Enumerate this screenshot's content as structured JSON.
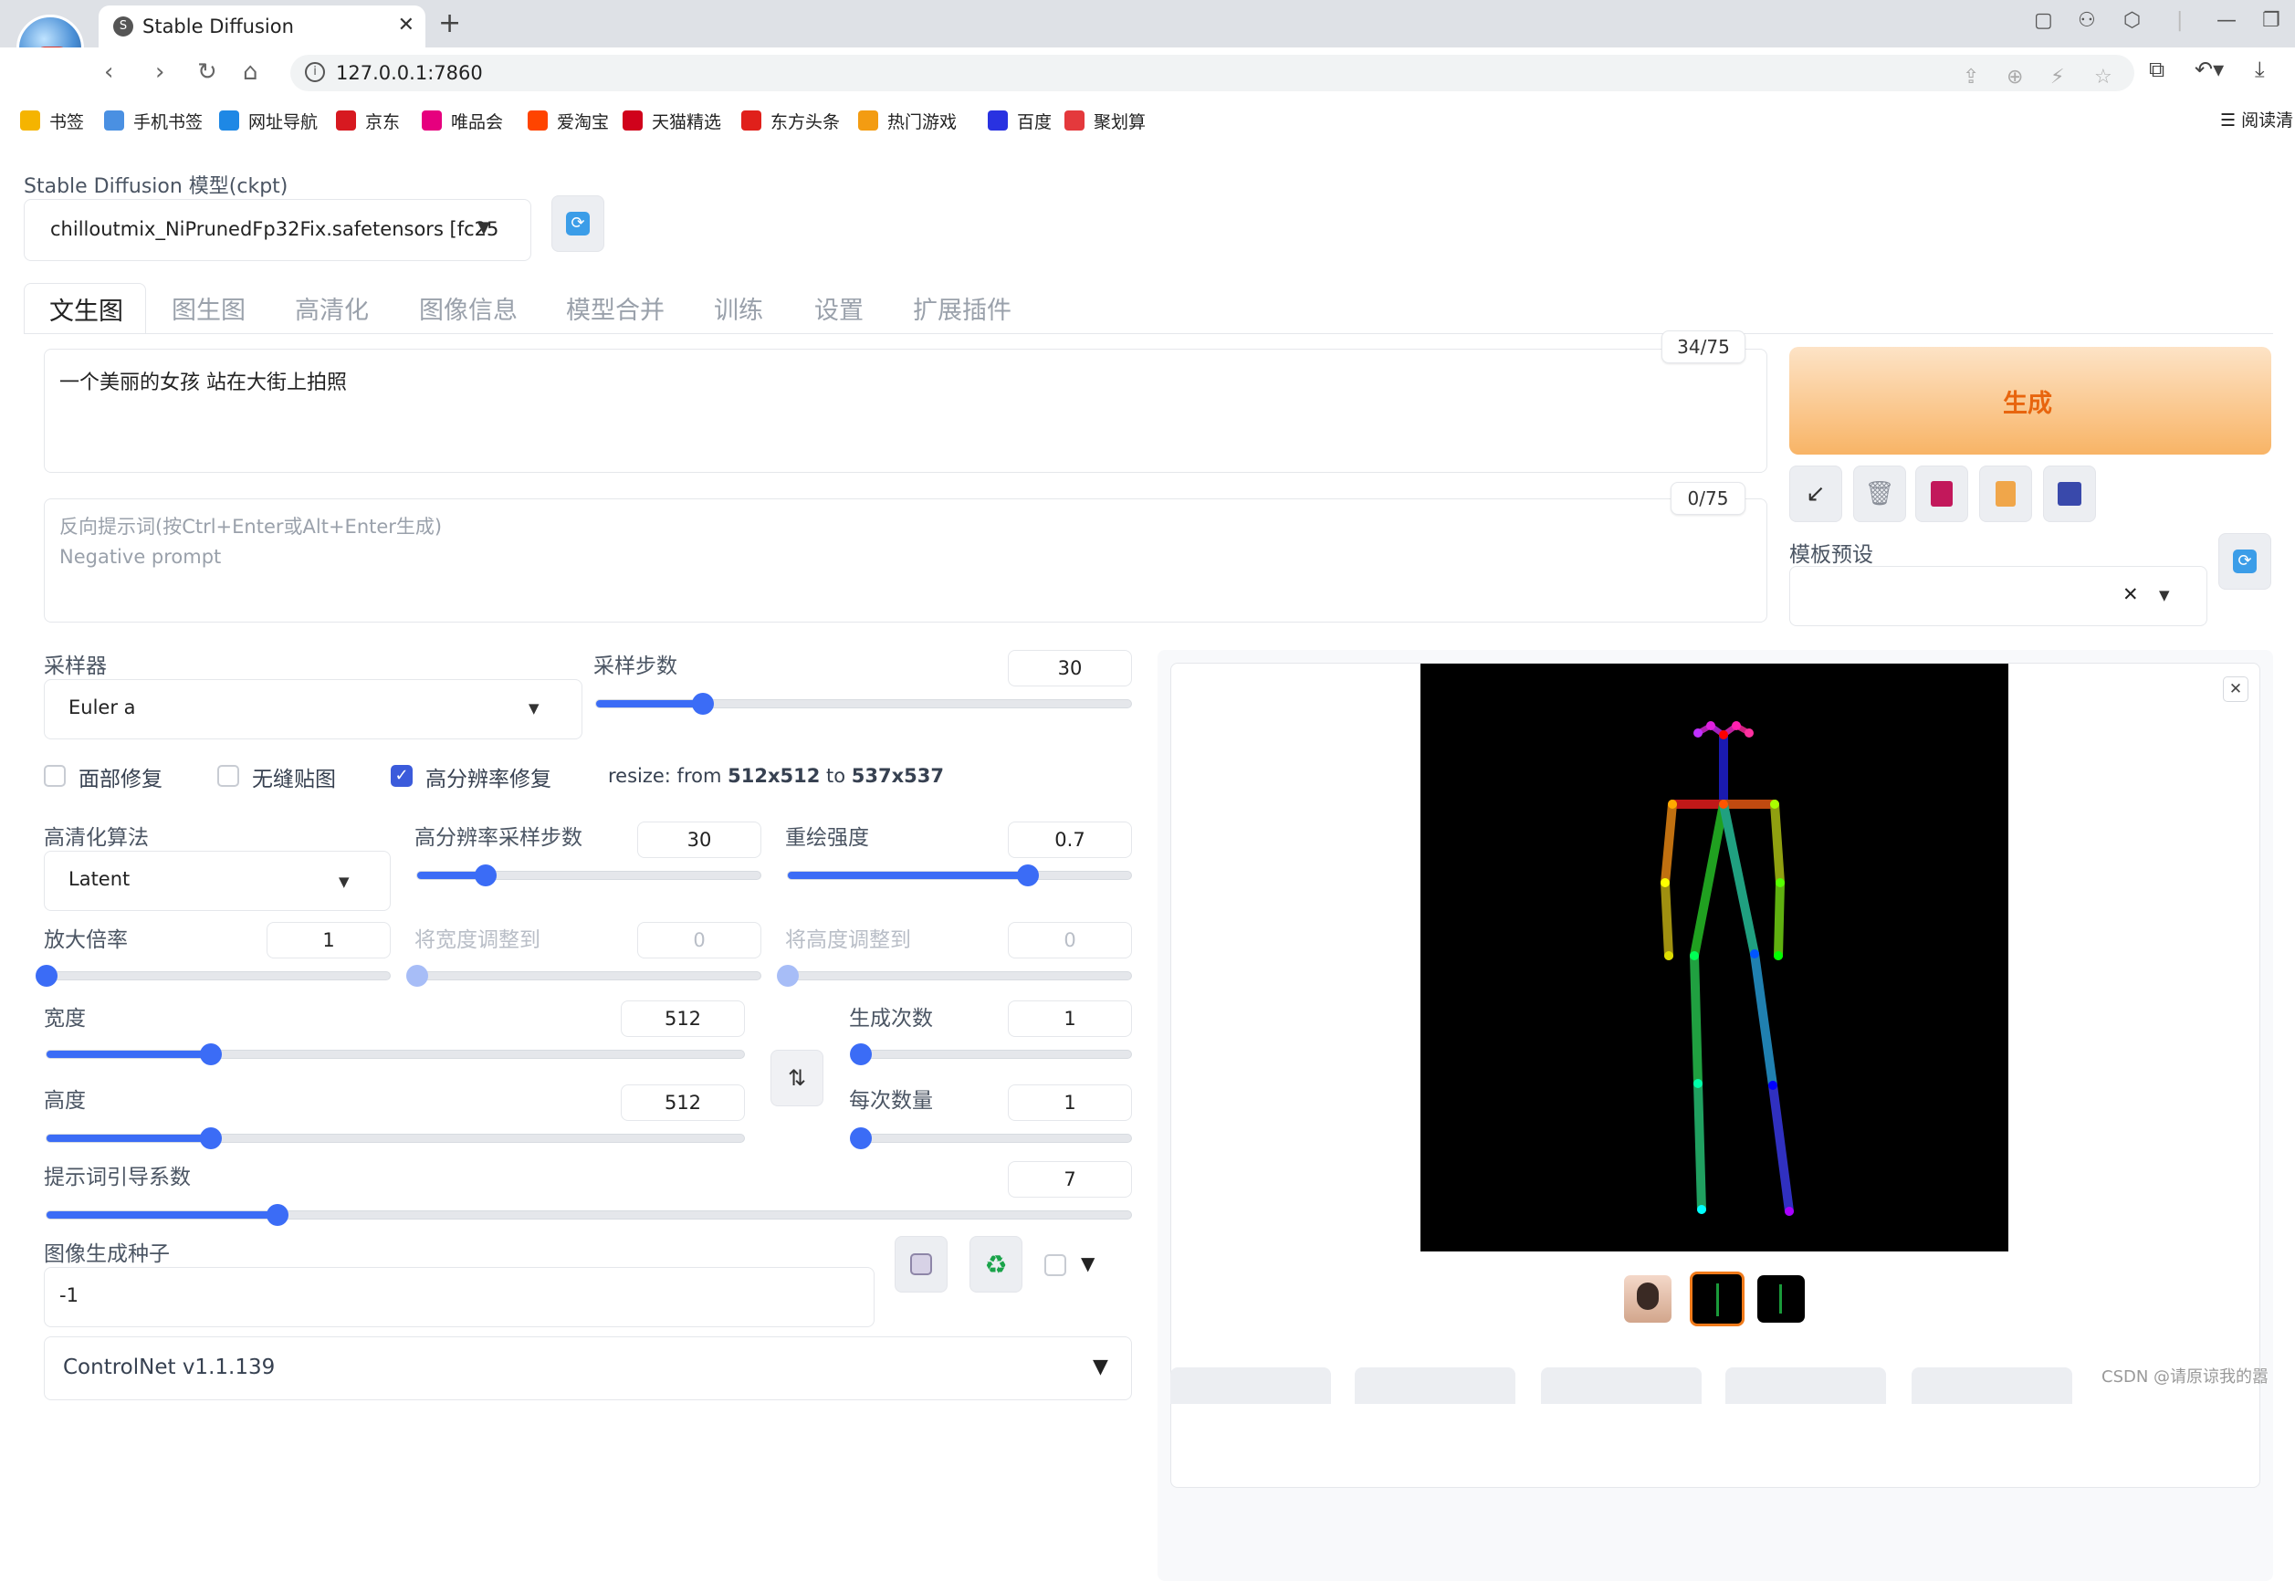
{
  "browser": {
    "tab_title": "Stable Diffusion",
    "url": "127.0.0.1:7860",
    "bookmarks": [
      {
        "label": "书签",
        "icon": "star-icon",
        "color": "#f5b400"
      },
      {
        "label": "手机书签",
        "icon": "phone-bookmark-icon",
        "color": "#4a90e2"
      },
      {
        "label": "网址导航",
        "icon": "navigation-icon",
        "color": "#1e88e5"
      },
      {
        "label": "京东",
        "icon": "jd-icon",
        "color": "#d71920"
      },
      {
        "label": "唯品会",
        "icon": "vip-icon",
        "color": "#e6007e"
      },
      {
        "label": "爱淘宝",
        "icon": "taobao-icon",
        "color": "#ff4400"
      },
      {
        "label": "天猫精选",
        "icon": "tmall-icon",
        "color": "#d0021b"
      },
      {
        "label": "东方头条",
        "icon": "toutiao-icon",
        "color": "#e0201b"
      },
      {
        "label": "热门游戏",
        "icon": "game-icon",
        "color": "#f39c12"
      },
      {
        "label": "百度",
        "icon": "baidu-icon",
        "color": "#2932e1"
      },
      {
        "label": "聚划算",
        "icon": "juhuasuan-icon",
        "color": "#e4393c"
      }
    ],
    "reader_label": "阅读清"
  },
  "model": {
    "label": "Stable Diffusion 模型(ckpt)",
    "value": "chilloutmix_NiPrunedFp32Fix.safetensors [fc25"
  },
  "tabs": [
    "文生图",
    "图生图",
    "高清化",
    "图像信息",
    "模型合并",
    "训练",
    "设置",
    "扩展插件"
  ],
  "prompt": {
    "text": "一个美丽的女孩 站在大街上拍照",
    "counter": "34/75",
    "neg_placeholder": "反向提示词(按Ctrl+Enter或Alt+Enter生成)\nNegative prompt",
    "neg_counter": "0/75"
  },
  "generate": {
    "label": "生成",
    "accent": "#f7a54a",
    "text_color": "#e8650e"
  },
  "style_preset": {
    "label": "模板预设",
    "clear": "✕"
  },
  "sampler": {
    "label": "采样器",
    "value": "Euler a"
  },
  "steps": {
    "label": "采样步数",
    "value": "30",
    "fraction": 0.2
  },
  "checkboxes": {
    "face_restore": "面部修复",
    "tiling": "无缝贴图",
    "hires": "高分辨率修复",
    "hires_checked": true
  },
  "resize_info": {
    "prefix": "resize: from ",
    "from": "512x512",
    "mid": " to ",
    "to": "537x537"
  },
  "hires": {
    "upscaler_label": "高清化算法",
    "upscaler_value": "Latent",
    "steps_label": "高分辨率采样步数",
    "steps_value": "30",
    "steps_fraction": 0.2,
    "denoise_label": "重绘强度",
    "denoise_value": "0.7",
    "denoise_fraction": 0.7,
    "scale_label": "放大倍率",
    "scale_value": "1",
    "scale_fraction": 0.0,
    "resize_w_label": "将宽度调整到",
    "resize_w_value": "0",
    "resize_h_label": "将高度调整到",
    "resize_h_value": "0"
  },
  "size": {
    "width_label": "宽度",
    "width_value": "512",
    "width_fraction": 0.235,
    "height_label": "高度",
    "height_value": "512",
    "height_fraction": 0.235
  },
  "batch": {
    "count_label": "生成次数",
    "count_value": "1",
    "count_fraction": 0.0,
    "size_label": "每次数量",
    "size_value": "1",
    "size_fraction": 0.0
  },
  "cfg": {
    "label": "提示词引导系数",
    "value": "7",
    "fraction": 0.213
  },
  "seed": {
    "label": "图像生成种子",
    "value": "-1"
  },
  "controlnet": {
    "label": "ControlNet v1.1.139"
  },
  "watermark": "CSDN @请原谅我的嚣"
}
